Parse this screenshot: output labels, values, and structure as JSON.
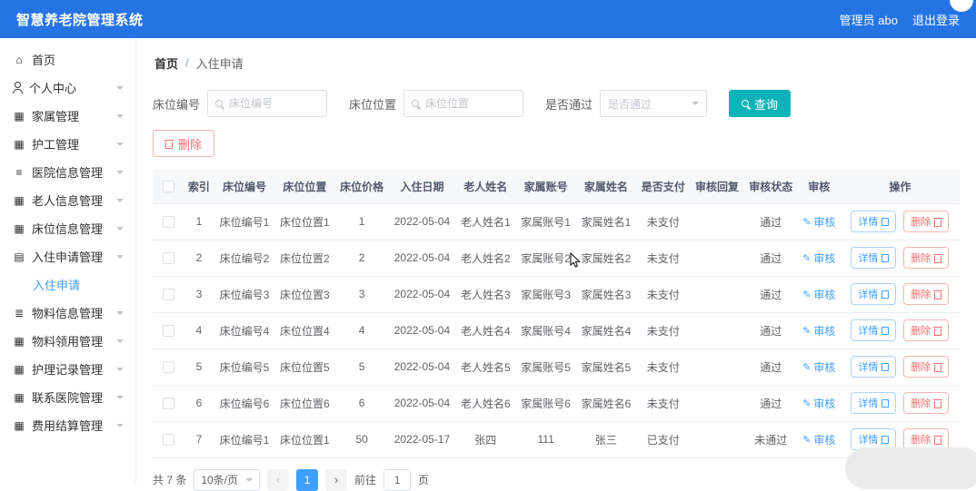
{
  "colors": {
    "header_bg": "#2574e4",
    "primary": "#409eff",
    "teal": "#0db3b9",
    "danger": "#f56c6c"
  },
  "header": {
    "title": "智慧养老院管理系统",
    "user": "管理员 abo",
    "logout": "退出登录"
  },
  "icons": {
    "home": "⌂",
    "user": "",
    "grid": "▦",
    "list": "≡",
    "board": "▤",
    "sliders": "≣",
    "edit": "✎"
  },
  "sidebar": {
    "items": [
      {
        "label": "首页",
        "icon": "home",
        "expandable": false
      },
      {
        "label": "个人中心",
        "icon": "user",
        "expandable": true
      },
      {
        "label": "家属管理",
        "icon": "grid",
        "expandable": true
      },
      {
        "label": "护工管理",
        "icon": "grid",
        "expandable": true
      },
      {
        "label": "医院信息管理",
        "icon": "list",
        "expandable": true
      },
      {
        "label": "老人信息管理",
        "icon": "grid",
        "expandable": true
      },
      {
        "label": "床位信息管理",
        "icon": "grid",
        "expandable": true
      },
      {
        "label": "入住申请管理",
        "icon": "board",
        "expandable": true,
        "children": [
          {
            "label": "入住申请",
            "active": true
          }
        ]
      },
      {
        "label": "物料信息管理",
        "icon": "sliders",
        "expandable": true
      },
      {
        "label": "物料领用管理",
        "icon": "grid",
        "expandable": true
      },
      {
        "label": "护理记录管理",
        "icon": "grid",
        "expandable": true
      },
      {
        "label": "联系医院管理",
        "icon": "grid",
        "expandable": true
      },
      {
        "label": "费用结算管理",
        "icon": "grid",
        "expandable": true
      }
    ]
  },
  "breadcrumb": {
    "home": "首页",
    "separator": "/",
    "current": "入住申请"
  },
  "filters": {
    "bed_no": {
      "label": "床位编号",
      "placeholder": "床位编号"
    },
    "bed_pos": {
      "label": "床位位置",
      "placeholder": "床位位置"
    },
    "passed": {
      "label": "是否通过",
      "placeholder": "是否通过"
    },
    "search_label": "查询",
    "delete_label": "删除"
  },
  "table": {
    "columns": [
      {
        "key": "index",
        "label": "索引"
      },
      {
        "key": "bed_no",
        "label": "床位编号"
      },
      {
        "key": "bed_pos",
        "label": "床位位置"
      },
      {
        "key": "price",
        "label": "床位价格"
      },
      {
        "key": "date",
        "label": "入住日期"
      },
      {
        "key": "elder_name",
        "label": "老人姓名"
      },
      {
        "key": "family_account",
        "label": "家属账号"
      },
      {
        "key": "family_name",
        "label": "家属姓名"
      },
      {
        "key": "paid",
        "label": "是否支付"
      },
      {
        "key": "review_reply",
        "label": "审核回复"
      },
      {
        "key": "review_status",
        "label": "审核状态"
      },
      {
        "key": "review",
        "label": "审核"
      },
      {
        "key": "actions",
        "label": "操作"
      }
    ],
    "review_link": "审核",
    "detail_button": "详情",
    "delete_button": "删除",
    "rows": [
      {
        "index": "1",
        "bed_no": "床位编号1",
        "bed_pos": "床位位置1",
        "price": "1",
        "date": "2022-05-04",
        "elder_name": "老人姓名1",
        "family_account": "家属账号1",
        "family_name": "家属姓名1",
        "paid": "未支付",
        "review_reply": "",
        "review_status": "通过"
      },
      {
        "index": "2",
        "bed_no": "床位编号2",
        "bed_pos": "床位位置2",
        "price": "2",
        "date": "2022-05-04",
        "elder_name": "老人姓名2",
        "family_account": "家属账号2",
        "family_name": "家属姓名2",
        "paid": "未支付",
        "review_reply": "",
        "review_status": "通过"
      },
      {
        "index": "3",
        "bed_no": "床位编号3",
        "bed_pos": "床位位置3",
        "price": "3",
        "date": "2022-05-04",
        "elder_name": "老人姓名3",
        "family_account": "家属账号3",
        "family_name": "家属姓名3",
        "paid": "未支付",
        "review_reply": "",
        "review_status": "通过"
      },
      {
        "index": "4",
        "bed_no": "床位编号4",
        "bed_pos": "床位位置4",
        "price": "4",
        "date": "2022-05-04",
        "elder_name": "老人姓名4",
        "family_account": "家属账号4",
        "family_name": "家属姓名4",
        "paid": "未支付",
        "review_reply": "",
        "review_status": "通过"
      },
      {
        "index": "5",
        "bed_no": "床位编号5",
        "bed_pos": "床位位置5",
        "price": "5",
        "date": "2022-05-04",
        "elder_name": "老人姓名5",
        "family_account": "家属账号5",
        "family_name": "家属姓名5",
        "paid": "未支付",
        "review_reply": "",
        "review_status": "通过"
      },
      {
        "index": "6",
        "bed_no": "床位编号6",
        "bed_pos": "床位位置6",
        "price": "6",
        "date": "2022-05-04",
        "elder_name": "老人姓名6",
        "family_account": "家属账号6",
        "family_name": "家属姓名6",
        "paid": "未支付",
        "review_reply": "",
        "review_status": "通过"
      },
      {
        "index": "7",
        "bed_no": "床位编号1",
        "bed_pos": "床位位置1",
        "price": "50",
        "date": "2022-05-17",
        "elder_name": "张四",
        "family_account": "111",
        "family_name": "张三",
        "paid": "已支付",
        "review_reply": "",
        "review_status": "未通过"
      }
    ]
  },
  "pagination": {
    "total_text": "共 7 条",
    "page_size": "10条/页",
    "prev": "‹",
    "next": "›",
    "current_page": "1",
    "goto_prefix": "前往",
    "goto_value": "1",
    "goto_suffix": "页"
  }
}
